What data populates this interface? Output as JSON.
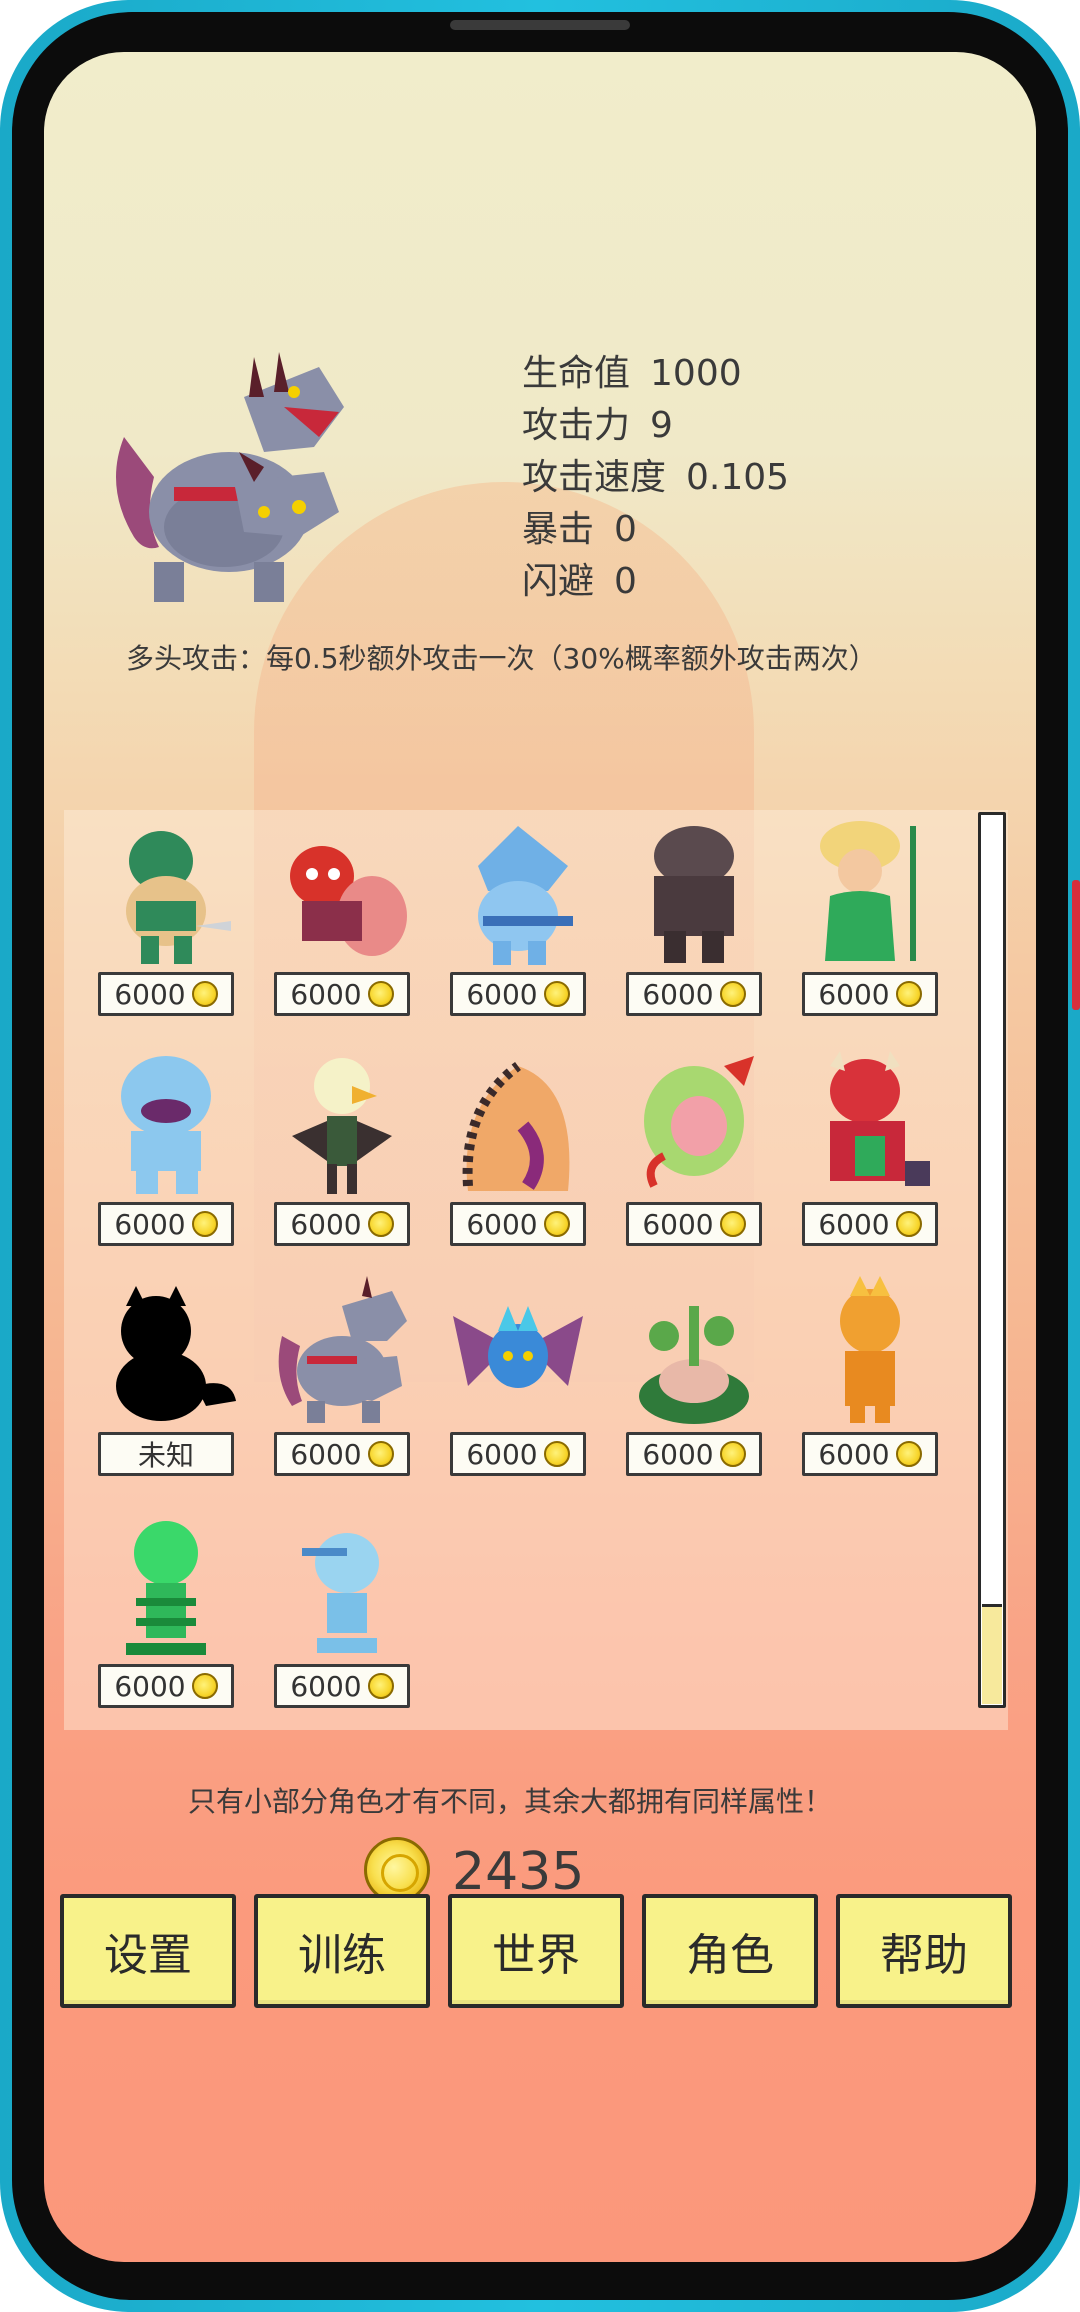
{
  "hero": {
    "stats": [
      {
        "label": "生命值",
        "value": "1000"
      },
      {
        "label": "攻击力",
        "value": "9"
      },
      {
        "label": "攻击速度",
        "value": "0.105"
      },
      {
        "label": "暴击",
        "value": "0"
      },
      {
        "label": "闪避",
        "value": "0"
      }
    ],
    "skill": "多头攻击：每0.5秒额外攻击一次（30%概率额外攻击两次）"
  },
  "characters": [
    {
      "price": "6000"
    },
    {
      "price": "6000"
    },
    {
      "price": "6000"
    },
    {
      "price": "6000"
    },
    {
      "price": "6000"
    },
    {
      "price": "6000"
    },
    {
      "price": "6000"
    },
    {
      "price": "6000"
    },
    {
      "price": "6000"
    },
    {
      "price": "6000"
    },
    {
      "price": "未知"
    },
    {
      "price": "6000"
    },
    {
      "price": "6000"
    },
    {
      "price": "6000"
    },
    {
      "price": "6000"
    },
    {
      "price": "6000"
    },
    {
      "price": "6000"
    }
  ],
  "info_text": "只有小部分角色才有不同，其余大都拥有同样属性！",
  "coins": "2435",
  "nav": {
    "settings": "设置",
    "training": "训练",
    "world": "世界",
    "character": "角色",
    "help": "帮助"
  },
  "colors": {
    "button_fill": "#f8f28a",
    "phone_frame": "#1aa9c8",
    "bg_top": "#f1edcb",
    "bg_bottom": "#fb977b"
  }
}
